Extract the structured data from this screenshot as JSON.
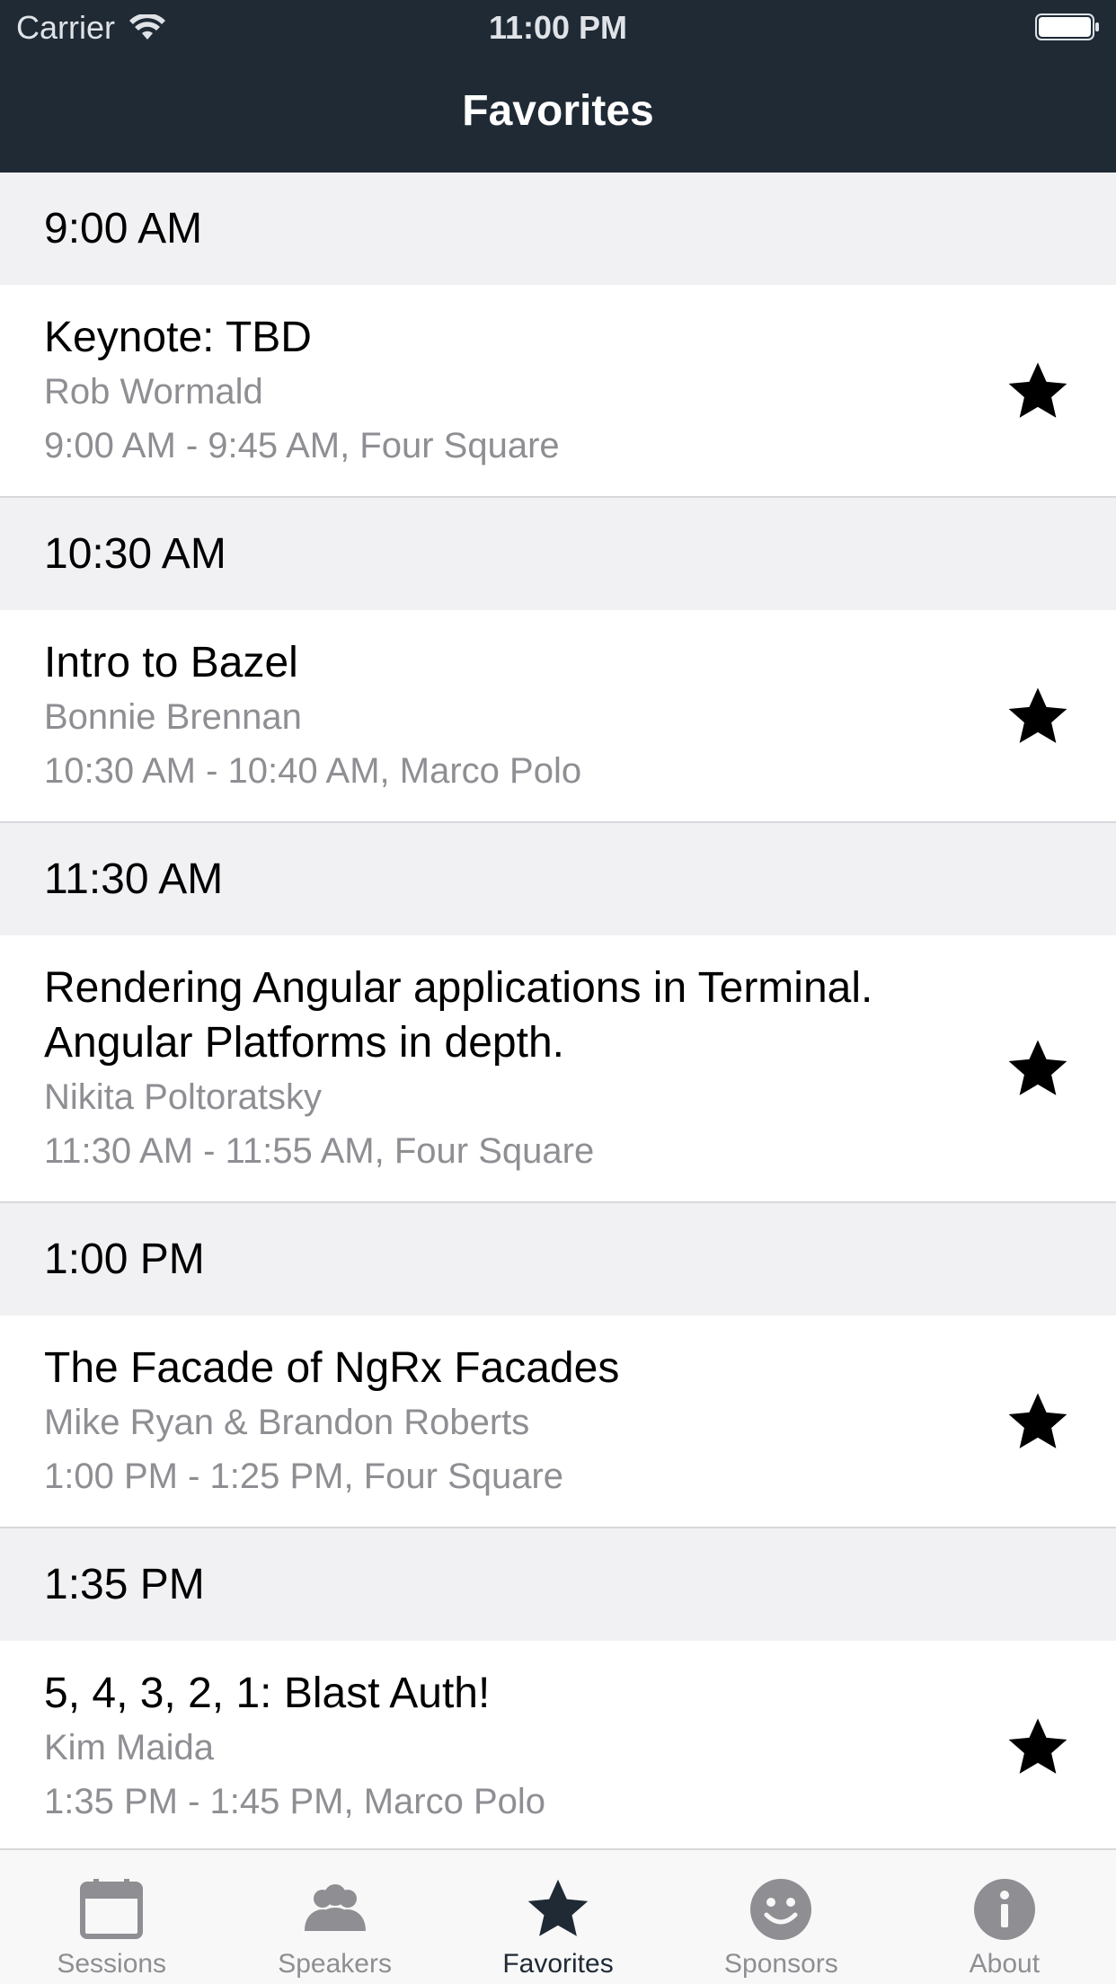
{
  "status": {
    "carrier": "Carrier",
    "time": "11:00 PM"
  },
  "nav": {
    "title": "Favorites"
  },
  "colors": {
    "navbar": "#1f2a35",
    "secondary_text": "#8e8e93",
    "section_bg": "#f1f1f3",
    "tab_inactive": "#8e8e93",
    "tab_active": "#1f2a35"
  },
  "sections": [
    {
      "header": "9:00 AM",
      "title": "Keynote: TBD",
      "speaker": "Rob Wormald",
      "time": "9:00 AM - 9:45 AM, Four Square",
      "favorited": true
    },
    {
      "header": "10:30 AM",
      "title": "Intro to Bazel",
      "speaker": "Bonnie Brennan",
      "time": "10:30 AM - 10:40 AM, Marco Polo",
      "favorited": true
    },
    {
      "header": "11:30 AM",
      "title": "Rendering Angular applications in Terminal. Angular Platforms in depth.",
      "speaker": "Nikita Poltoratsky",
      "time": "11:30 AM - 11:55 AM, Four Square",
      "favorited": true
    },
    {
      "header": "1:00 PM",
      "title": "The Facade of NgRx Facades",
      "speaker": "Mike Ryan & Brandon Roberts",
      "time": "1:00 PM - 1:25 PM, Four Square",
      "favorited": true
    },
    {
      "header": "1:35 PM",
      "title": "5, 4, 3, 2, 1: Blast Auth!",
      "speaker": "Kim Maida",
      "time": "1:35 PM - 1:45 PM, Marco Polo",
      "favorited": true
    }
  ],
  "tabs": [
    {
      "label": "Sessions",
      "icon": "calendar-icon",
      "active": false
    },
    {
      "label": "Speakers",
      "icon": "people-icon",
      "active": false
    },
    {
      "label": "Favorites",
      "icon": "star-icon",
      "active": true
    },
    {
      "label": "Sponsors",
      "icon": "smiley-icon",
      "active": false
    },
    {
      "label": "About",
      "icon": "info-icon",
      "active": false
    }
  ]
}
